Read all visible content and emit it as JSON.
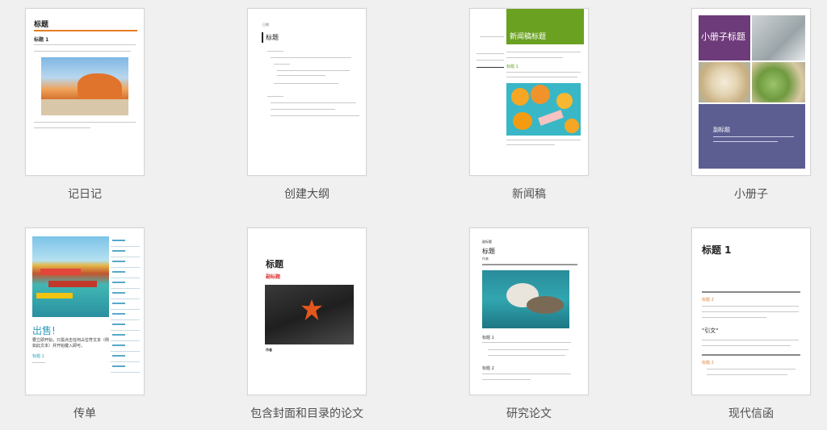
{
  "templates": [
    {
      "caption": "记日记",
      "thumb": {
        "title": "标题",
        "heading": "标题 1"
      }
    },
    {
      "caption": "创建大纲",
      "thumb": {
        "small_label": "日期",
        "title": "标题"
      }
    },
    {
      "caption": "新闻稿",
      "thumb": {
        "banner_title": "新闻稿标题",
        "heading": "标题 1"
      }
    },
    {
      "caption": "小册子",
      "thumb": {
        "title": "小册子标题",
        "subtitle": "副标题"
      }
    },
    {
      "caption": "传单",
      "thumb": {
        "sale_text": "出售!",
        "body": "要立即开始，只需点击任何占位符文本（例如此文本）并开始键入即可。",
        "heading": "标题 1"
      }
    },
    {
      "caption": "包含封面和目录的论文",
      "thumb": {
        "title": "标题",
        "subtitle": "副标题",
        "author": "作者"
      }
    },
    {
      "caption": "研究论文",
      "thumb": {
        "small_label": "副标题",
        "title": "标题",
        "author": "作者",
        "heading1": "标题 1",
        "heading2": "标题 2"
      }
    },
    {
      "caption": "现代信函",
      "thumb": {
        "title": "标题 1",
        "heading": "标题 2",
        "quote": "\"引文\"",
        "heading2": "标题 2"
      }
    }
  ],
  "colors": {
    "accent_orange": "#e67e22",
    "news_green": "#6aa121",
    "booklet_purple": "#6e3b7a",
    "booklet_slate": "#5c5e92",
    "flyer_teal": "#2e9cbe",
    "paper_red": "#e03a3a",
    "letter_orange": "#e0843d"
  }
}
